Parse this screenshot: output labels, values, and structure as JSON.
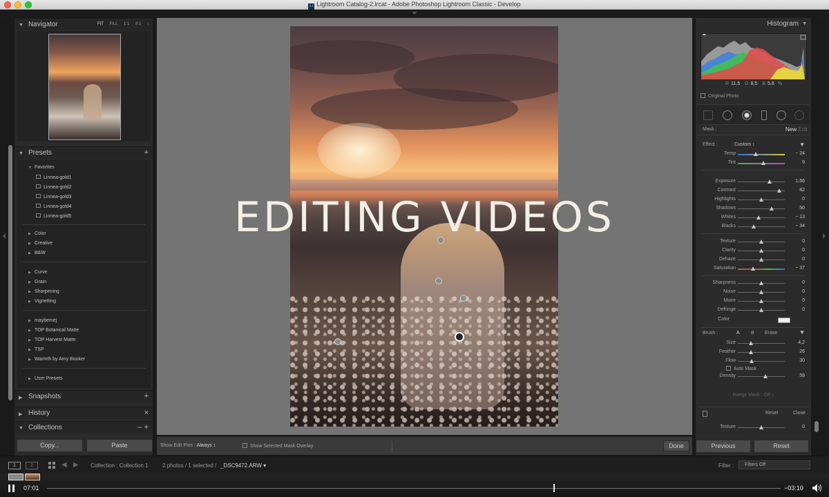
{
  "window": {
    "title": "Lightroom Catalog-2.lrcat - Adobe Photoshop Lightroom Classic - Develop",
    "badge": "Lr"
  },
  "navigator": {
    "title": "Navigator",
    "options": [
      "FIT",
      "FILL",
      "1:1",
      "8:1"
    ],
    "more": "↕"
  },
  "presets": {
    "title": "Presets",
    "add": "+",
    "favorites": {
      "label": "Favorites",
      "items": [
        "Linnea-gold1",
        "Linnea-gold2",
        "Linnea-gold3",
        "Linnea-gold4",
        "Linnea-gold5"
      ]
    },
    "groups1": [
      "Color",
      "Creative",
      "B&W"
    ],
    "groups2": [
      "Curve",
      "Grain",
      "Sharpening",
      "Vignetting"
    ],
    "groups3": [
      "maybemej",
      "TOP Botanical Matte",
      "TOP Harvest Matte",
      "TSP",
      "Warmth by Amy Booker"
    ],
    "groups4": [
      "User Presets"
    ]
  },
  "snapshots": {
    "title": "Snapshots",
    "action": "+"
  },
  "history": {
    "title": "History",
    "action": "×"
  },
  "collections": {
    "title": "Collections",
    "actions": "–  +"
  },
  "left_buttons": {
    "copy": "Copy...",
    "paste": "Paste"
  },
  "overlay_title": "EDITING VIDEOS",
  "center_toolbar": {
    "pins_label": "Show Edit Pins :",
    "pins_value": "Always ↕",
    "mask_overlay": "Show Selected Mask Overlay",
    "done": "Done"
  },
  "histogram": {
    "title": "Histogram",
    "r_label": "R",
    "r_value": "11,5",
    "g_label": "G",
    "g_value": "8,5",
    "b_label": "B",
    "b_value": "5,8",
    "unit": "%",
    "original_photo": "Original Photo"
  },
  "mask": {
    "label": "Mask :",
    "new": "New",
    "edit": "Edit"
  },
  "effect": {
    "label": "Effect :",
    "value": "Custom ↕"
  },
  "sliders_wb": [
    {
      "label": "Temp",
      "value": "− 24",
      "pos": 0.38
    },
    {
      "label": "Tint",
      "value": "9",
      "pos": 0.55
    }
  ],
  "sliders_tone": [
    {
      "label": "Exposure",
      "value": "1,66",
      "pos": 0.68
    },
    {
      "label": "Contrast",
      "value": "82",
      "pos": 0.88
    },
    {
      "label": "Highlights",
      "value": "0",
      "pos": 0.5
    },
    {
      "label": "Shadows",
      "value": "50",
      "pos": 0.72
    },
    {
      "label": "Whites",
      "value": "− 13",
      "pos": 0.44
    },
    {
      "label": "Blacks",
      "value": "− 34",
      "pos": 0.34
    }
  ],
  "sliders_presence": [
    {
      "label": "Texture",
      "value": "0",
      "pos": 0.5
    },
    {
      "label": "Clarity",
      "value": "0",
      "pos": 0.5
    },
    {
      "label": "Dehaze",
      "value": "0",
      "pos": 0.5
    },
    {
      "label": "Saturation",
      "value": "− 37",
      "pos": 0.33
    }
  ],
  "sliders_detail": [
    {
      "label": "Sharpness",
      "value": "0",
      "pos": 0.5
    },
    {
      "label": "Noise",
      "value": "0",
      "pos": 0.5
    },
    {
      "label": "Moire",
      "value": "0",
      "pos": 0.5
    },
    {
      "label": "Defringe",
      "value": "0",
      "pos": 0.5
    }
  ],
  "color_label": "Color",
  "brush": {
    "label": "Brush :",
    "a": "A",
    "b": "B",
    "erase": "Erase"
  },
  "sliders_brush": [
    {
      "label": "Size",
      "value": "4,2",
      "pos": 0.28
    },
    {
      "label": "Feather",
      "value": "26",
      "pos": 0.28
    },
    {
      "label": "Flow",
      "value": "30",
      "pos": 0.3
    }
  ],
  "automask": "Auto Mask",
  "density": {
    "label": "Density",
    "value": "59",
    "pos": 0.59
  },
  "range_mask": "Range Mask : Off ↕",
  "reset": "Reset",
  "close": "Close",
  "texture_row": {
    "label": "Texture",
    "value": "0",
    "pos": 0.5
  },
  "right_buttons": {
    "previous": "Previous",
    "reset": "Reset"
  },
  "filmstrip": {
    "monitor1": "1",
    "monitor2": "2",
    "collection": "Collection : Collection 1",
    "selection": "2 photos / 1 selected /",
    "filename": "_DSC9472.ARW ▾",
    "filter_label": "Filter :",
    "filter_value": "Filters Off"
  },
  "video": {
    "elapsed": "07:01",
    "remaining": "−03:10",
    "progress": 0.69
  }
}
